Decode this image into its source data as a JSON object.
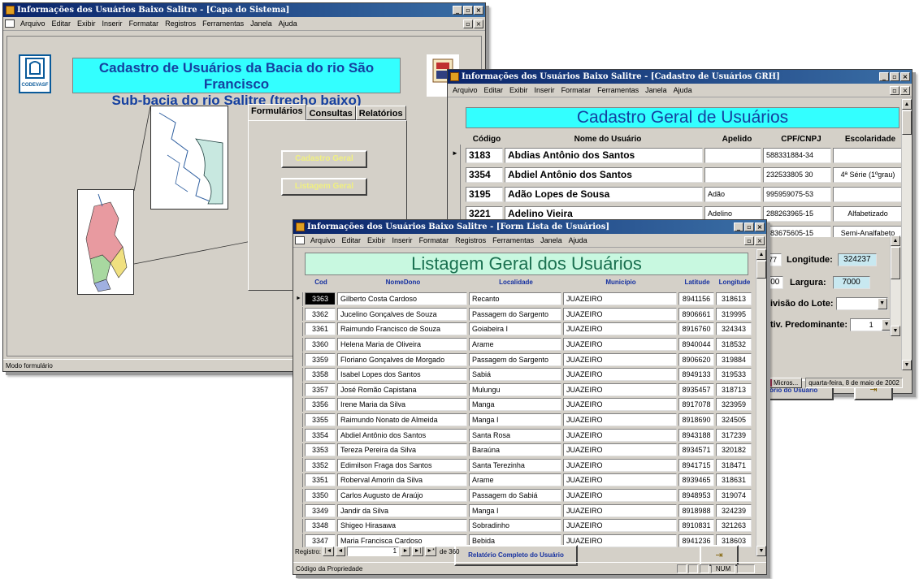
{
  "win1": {
    "title": "Informações dos Usuários Baixo Salitre - [Capa do Sistema]",
    "menu": [
      "Arquivo",
      "Editar",
      "Exibir",
      "Inserir",
      "Formatar",
      "Registros",
      "Ferramentas",
      "Janela",
      "Ajuda"
    ],
    "logo_left_label": "CODEVASF",
    "logo_right_label": "uni",
    "heading1": "Cadastro de Usuários da Bacia do rio São Francisco",
    "heading2": "Sub-bacia do rio Salitre (trecho baixo)",
    "tabs": [
      "Formulários",
      "Consultas",
      "Relatórios"
    ],
    "btn_cadastro": "Cadastro Geral",
    "btn_listagem": "Listagem Geral",
    "status": "Modo formulário"
  },
  "win2": {
    "title": "Informações dos Usuários Baixo Salitre - [Cadastro de Usuários GRH]",
    "menu": [
      "Arquivo",
      "Editar",
      "Exibir",
      "Inserir",
      "Formatar",
      "Ferramentas",
      "Janela",
      "Ajuda"
    ],
    "heading": "Cadastro Geral de Usuários",
    "columns": [
      "Código",
      "Nome do Usuário",
      "Apelido",
      "CPF/CNPJ",
      "Escolaridade"
    ],
    "rows": [
      {
        "cod": "3183",
        "nome": "Abdias Antônio dos Santos",
        "apelido": "",
        "cpf": "588331884-34",
        "esc": ""
      },
      {
        "cod": "3354",
        "nome": "Abdiel Antônio dos Santos",
        "apelido": "",
        "cpf": "232533805 30",
        "esc": "4ª Série (1ºgrau)"
      },
      {
        "cod": "3195",
        "nome": "Adão Lopes de Sousa",
        "apelido": "Adão",
        "cpf": "995959075-53",
        "esc": ""
      },
      {
        "cod": "3221",
        "nome": "Adelino Vieira",
        "apelido": "Adelino",
        "cpf": "288263965-15",
        "esc": "Alfabetizado"
      },
      {
        "cod": "",
        "nome": "",
        "apelido": "",
        "cpf": "983675605-15",
        "esc": "Semi-Analfabeto"
      }
    ],
    "lat_suffix": "077",
    "longitude_label": "Longitude:",
    "longitude_value": "324237",
    "width_value": "200",
    "largura_label": "Largura:",
    "largura_value": "7000",
    "divisao_label": "Divisão do Lote:",
    "atividade_label": "Ativ. Predominante:",
    "atividade_value": "1",
    "btn_relatorio": "atório do Usuário",
    "taskbar_app": "Micros...",
    "taskbar_date": "quarta-feira, 8 de maio de 2002"
  },
  "win3": {
    "title": "Informações dos Usuários Baixo Salitre - [Form Lista de Usuários]",
    "menu": [
      "Arquivo",
      "Editar",
      "Exibir",
      "Inserir",
      "Formatar",
      "Registros",
      "Ferramentas",
      "Janela",
      "Ajuda"
    ],
    "heading": "Listagem Geral dos Usuários",
    "columns": [
      "Cod",
      "NomeDono",
      "Localidade",
      "Município",
      "Latitude",
      "Longitude"
    ],
    "rows": [
      [
        "3363",
        "Gilberto Costa Cardoso",
        "Recanto",
        "JUAZEIRO",
        "8941156",
        "318613"
      ],
      [
        "3362",
        "Jucelino Gonçalves de Souza",
        "Passagem do Sargento",
        "JUAZEIRO",
        "8906661",
        "319995"
      ],
      [
        "3361",
        "Raimundo Francisco de Souza",
        "Goiabeira I",
        "JUAZEIRO",
        "8916760",
        "324343"
      ],
      [
        "3360",
        "Helena Maria de Oliveira",
        "Arame",
        "JUAZEIRO",
        "8940044",
        "318532"
      ],
      [
        "3359",
        "Floriano Gonçalves de Morgado",
        "Passagem do Sargento",
        "JUAZEIRO",
        "8906620",
        "319884"
      ],
      [
        "3358",
        "Isabel Lopes dos Santos",
        "Sabiá",
        "JUAZEIRO",
        "8949133",
        "319533"
      ],
      [
        "3357",
        "José Romão Capistana",
        "Mulungu",
        "JUAZEIRO",
        "8935457",
        "318713"
      ],
      [
        "3356",
        "Irene Maria da Silva",
        "Manga",
        "JUAZEIRO",
        "8917078",
        "323959"
      ],
      [
        "3355",
        "Raimundo Nonato de Almeida",
        "Manga I",
        "JUAZEIRO",
        "8918690",
        "324505"
      ],
      [
        "3354",
        "Abdiel Antônio dos Santos",
        "Santa Rosa",
        "JUAZEIRO",
        "8943188",
        "317239"
      ],
      [
        "3353",
        "Tereza Pereira da Silva",
        "Baraúna",
        "JUAZEIRO",
        "8934571",
        "320182"
      ],
      [
        "3352",
        "Edimilson Fraga dos Santos",
        "Santa Terezinha",
        "JUAZEIRO",
        "8941715",
        "318471"
      ],
      [
        "3351",
        "Roberval Amorin da Silva",
        "Arame",
        "JUAZEIRO",
        "8939465",
        "318631"
      ],
      [
        "3350",
        "Carlos Augusto de Araújo",
        "Passagem do Sabiá",
        "JUAZEIRO",
        "8948953",
        "319074"
      ],
      [
        "3349",
        "Jandir da Silva",
        "Manga I",
        "JUAZEIRO",
        "8918988",
        "324239"
      ],
      [
        "3348",
        "Shigeo Hirasawa",
        "Sobradinho",
        "JUAZEIRO",
        "8910831",
        "321263"
      ],
      [
        "3347",
        "Maria Francisca Cardoso",
        "Bebida",
        "JUAZEIRO",
        "8941236",
        "318603"
      ]
    ],
    "btn_relatorio": "Relatório Completo do Usuário",
    "nav_label": "Registro:",
    "nav_current": "1",
    "nav_total": "de 360",
    "status": "Código da Propriedade",
    "status_num": "NUM"
  }
}
